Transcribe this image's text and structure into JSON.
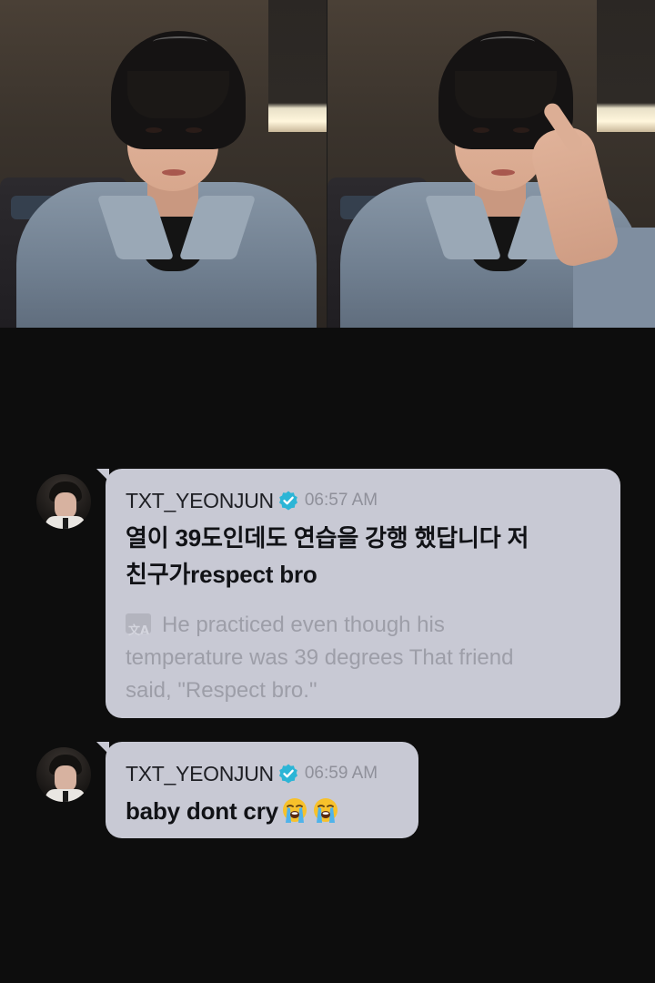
{
  "messages": [
    {
      "username": "TXT_YEONJUN",
      "verified_icon": "verified-badge-icon",
      "time": "06:57 AM",
      "text_line1": "열이 39도인데도 연습을 강행 했답니다 저",
      "text_line2": "친구가respect bro",
      "translation_line1": "He practiced even though his",
      "translation_line2": "temperature was 39 degrees That friend",
      "translation_line3": "said, \"Respect bro.\""
    },
    {
      "username": "TXT_YEONJUN",
      "verified_icon": "verified-badge-icon",
      "time": "06:59 AM",
      "text": "baby dont cry",
      "emojis": [
        "loudly-crying-face-icon",
        "loudly-crying-face-icon"
      ]
    }
  ],
  "colors": {
    "background": "#0d0d0d",
    "bubble": "#c8c9d4",
    "verified": "#2cb5d6",
    "timestamp": "#8f909a"
  }
}
